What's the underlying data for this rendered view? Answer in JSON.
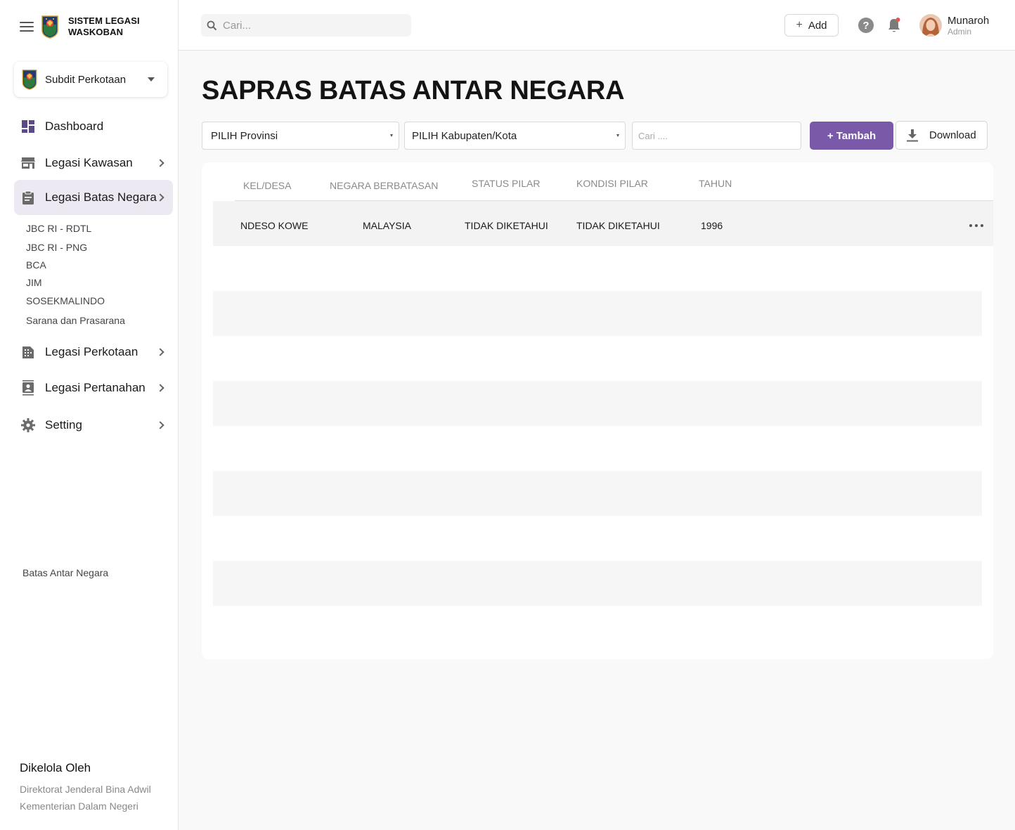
{
  "brand": {
    "title": "SISTEM LEGASI WASKOBAN"
  },
  "org_select": {
    "value": "Subdit Perkotaan"
  },
  "sidebar": {
    "items": [
      {
        "label": "Dashboard"
      },
      {
        "label": "Legasi Kawasan"
      },
      {
        "label": "Legasi Batas Negara"
      },
      {
        "label": "Legasi Perkotaan"
      },
      {
        "label": "Legasi Pertanahan"
      },
      {
        "label": "Setting"
      }
    ],
    "subitems": [
      "JBC RI - RDTL",
      "JBC RI - PNG",
      "BCA",
      "JIM",
      "SOSEKMALINDO",
      "Sarana dan Prasarana"
    ],
    "footer_label": "Batas Antar Negara",
    "managed_title": "Dikelola Oleh",
    "managed_lines": [
      "Direktorat Jenderal Bina Adwil",
      "Kementerian Dalam Negeri"
    ]
  },
  "topbar": {
    "search_placeholder": "Cari...",
    "add_label": "Add",
    "help": "?",
    "user_name": "Munaroh",
    "user_role": "Admin"
  },
  "main": {
    "title": "SAPRAS BATAS ANTAR NEGARA",
    "provinsi_select": "PILIH Provinsi",
    "kabupaten_select": "PILIH Kabupaten/Kota",
    "search_placeholder": "Cari ....",
    "tambah_label": "+ Tambah",
    "download_label": "Download"
  },
  "table": {
    "columns": [
      "KEL/DESA",
      "NEGARA BERBATASAN",
      "STATUS PILAR",
      "KONDISI PILAR",
      "TAHUN"
    ],
    "rows": [
      [
        "NDESO KOWE",
        "MALAYSIA",
        "TIDAK DIKETAHUI",
        "TIDAK DIKETAHUI",
        "1996"
      ]
    ]
  },
  "colors": {
    "accent": "#7a5aa8",
    "active_nav": "#ede9f3",
    "notification_dot": "#e2574c"
  },
  "icons": {
    "menu": "hamburger-icon",
    "search": "search-icon",
    "help": "help-icon",
    "notifications": "bell-icon",
    "dashboard": "dashboard-icon",
    "kawasan": "store-icon",
    "batas_negara": "clipboard-icon",
    "perkotaan": "building-icon",
    "pertanahan": "contact-icon",
    "setting": "gear-icon",
    "download": "download-icon",
    "row_actions": "more-horizontal-icon"
  }
}
